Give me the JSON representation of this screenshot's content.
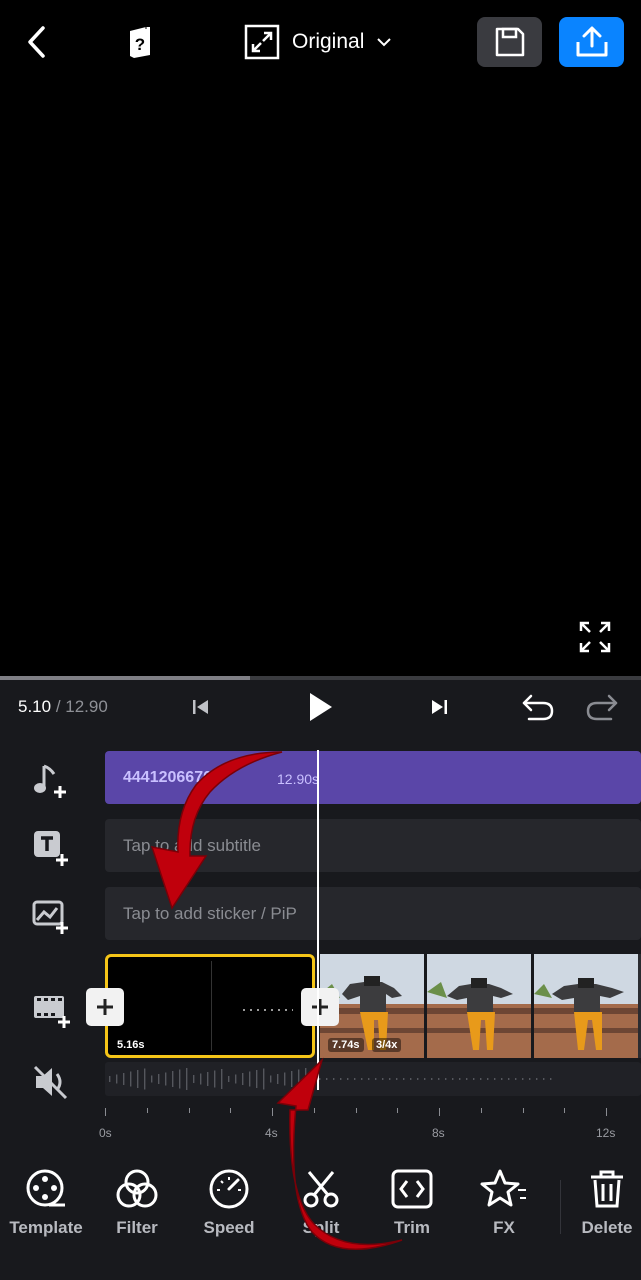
{
  "header": {
    "aspect_label": "Original"
  },
  "playback": {
    "current_time": "5.10",
    "total_time": " / 12.90",
    "progress": 0.39
  },
  "timeline": {
    "music_name": "4441206670",
    "music_duration": "12.90s",
    "subtitle_placeholder": "Tap to add subtitle",
    "sticker_placeholder": "Tap to add sticker / PiP",
    "clip1_duration": "5.16s",
    "clip2_duration": "7.74s",
    "clip2_speed": "3/4x",
    "ruler": [
      "0s",
      "4s",
      "8s",
      "12s"
    ]
  },
  "tools": [
    {
      "label": "Template",
      "icon": "template-icon"
    },
    {
      "label": "Filter",
      "icon": "filter-icon"
    },
    {
      "label": "Speed",
      "icon": "speed-icon"
    },
    {
      "label": "Split",
      "icon": "split-icon"
    },
    {
      "label": "Trim",
      "icon": "trim-icon"
    },
    {
      "label": "FX",
      "icon": "fx-icon"
    },
    {
      "label": "Delete",
      "icon": "delete-icon"
    }
  ],
  "colors": {
    "accent": "#0a84ff",
    "selected_clip": "#f5c518",
    "music_track": "#5a46a8",
    "annotation_arrow": "#c0000c"
  }
}
